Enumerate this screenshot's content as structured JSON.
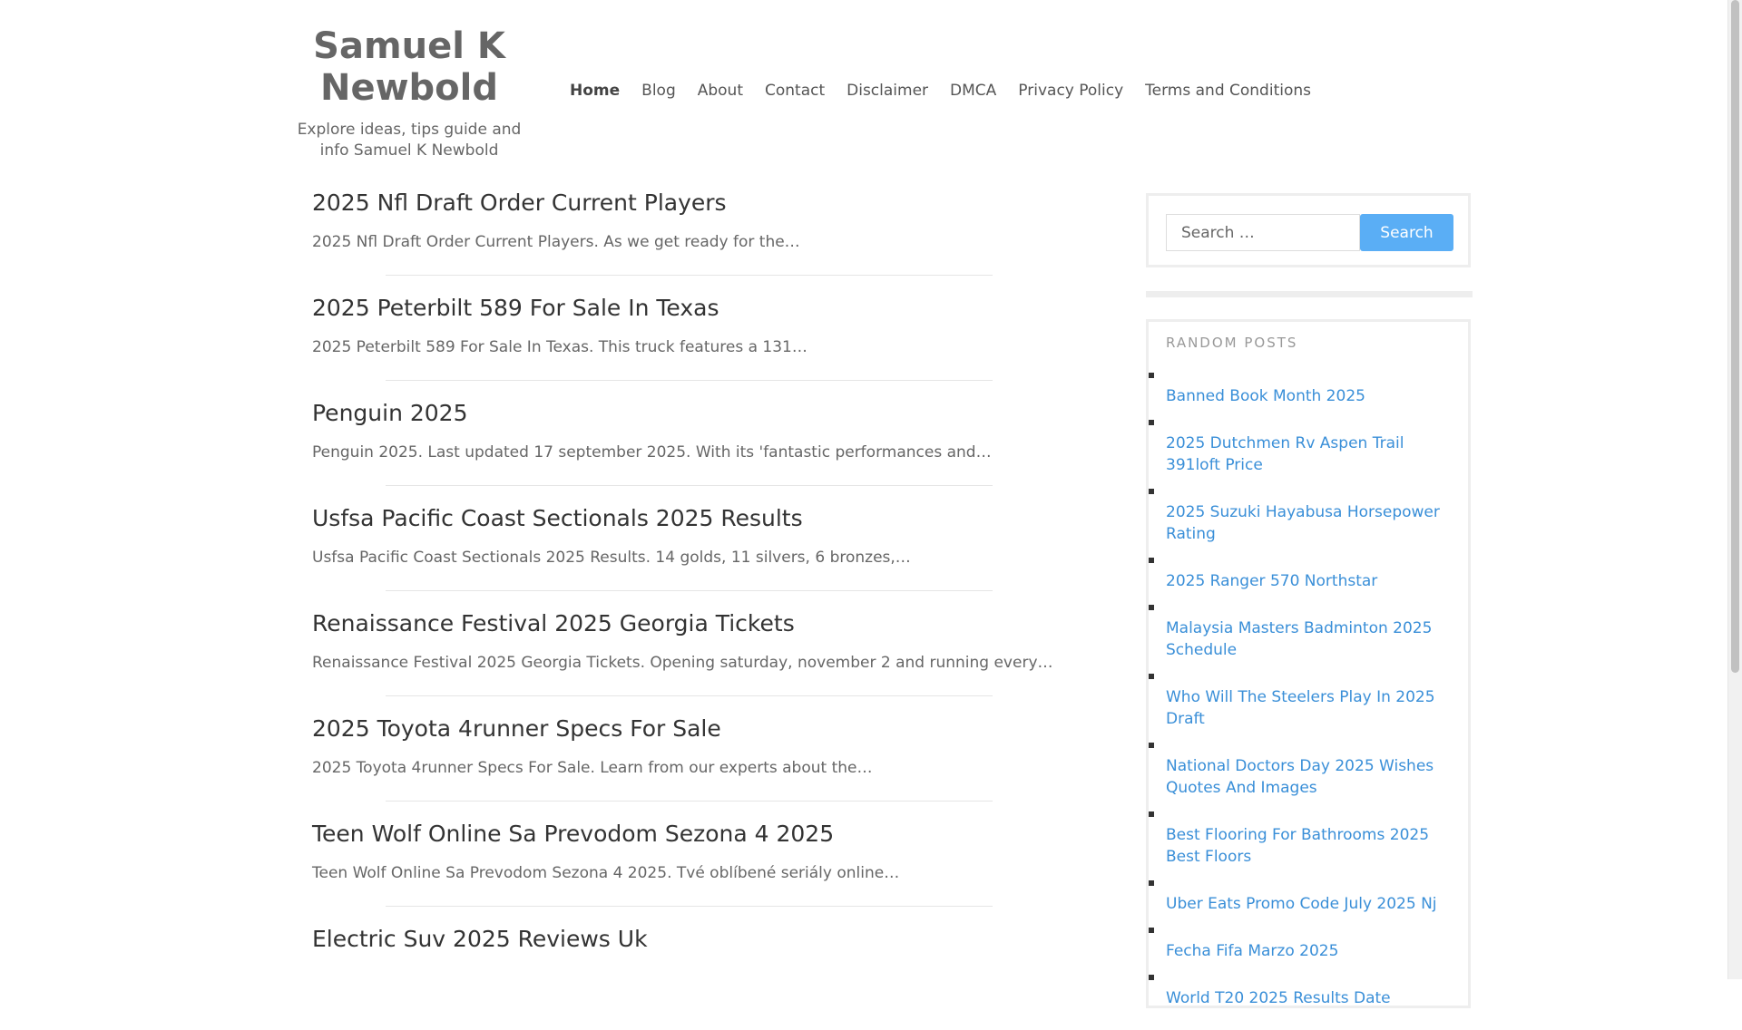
{
  "site": {
    "title": "Samuel K Newbold",
    "description": "Explore ideas, tips guide and info Samuel K Newbold"
  },
  "nav": {
    "items": [
      {
        "label": "Home",
        "current": true
      },
      {
        "label": "Blog"
      },
      {
        "label": "About"
      },
      {
        "label": "Contact"
      },
      {
        "label": "Disclaimer"
      },
      {
        "label": "DMCA"
      },
      {
        "label": "Privacy Policy"
      },
      {
        "label": "Terms and Conditions"
      }
    ]
  },
  "posts": [
    {
      "title": "2025 Nfl Draft Order Current Players",
      "excerpt": "2025 Nfl Draft Order Current Players. As we get ready for the…"
    },
    {
      "title": "2025 Peterbilt 589 For Sale In Texas",
      "excerpt": "2025 Peterbilt 589 For Sale In Texas. This truck features a 131…"
    },
    {
      "title": "Penguin 2025",
      "excerpt": "Penguin 2025. Last updated 17 september 2025. With its 'fantastic performances and…"
    },
    {
      "title": "Usfsa Pacific Coast Sectionals 2025 Results",
      "excerpt": "Usfsa Pacific Coast Sectionals 2025 Results. 14 golds, 11 silvers, 6 bronzes,…"
    },
    {
      "title": "Renaissance Festival 2025 Georgia Tickets",
      "excerpt": "Renaissance Festival 2025 Georgia Tickets. Opening saturday, november 2 and running every…"
    },
    {
      "title": "2025 Toyota 4runner Specs For Sale",
      "excerpt": "2025 Toyota 4runner Specs For Sale. Learn from our experts about the…"
    },
    {
      "title": "Teen Wolf Online Sa Prevodom Sezona 4 2025",
      "excerpt": "Teen Wolf Online Sa Prevodom Sezona 4 2025. Tvé oblíbené seriály online…"
    },
    {
      "title": "Electric Suv 2025 Reviews Uk",
      "excerpt": ""
    }
  ],
  "search": {
    "placeholder": "Search …",
    "button_label": "Search"
  },
  "random_posts": {
    "title": "Random Posts",
    "items": [
      "Banned Book Month 2025",
      "2025 Dutchmen Rv Aspen Trail 391loft Price",
      "2025 Suzuki Hayabusa Horsepower Rating",
      "2025 Ranger 570 Northstar",
      "Malaysia Masters Badminton 2025 Schedule",
      "Who Will The Steelers Play In 2025 Draft",
      "National Doctors Day 2025 Wishes Quotes And Images",
      "Best Flooring For Bathrooms 2025 Best Floors",
      "Uber Eats Promo Code July 2025 Nj",
      "Fecha Fifa Marzo 2025",
      "World T20 2025 Results Date"
    ]
  },
  "colors": {
    "accent": "#5aaef5",
    "link": "#3a8fd8"
  }
}
